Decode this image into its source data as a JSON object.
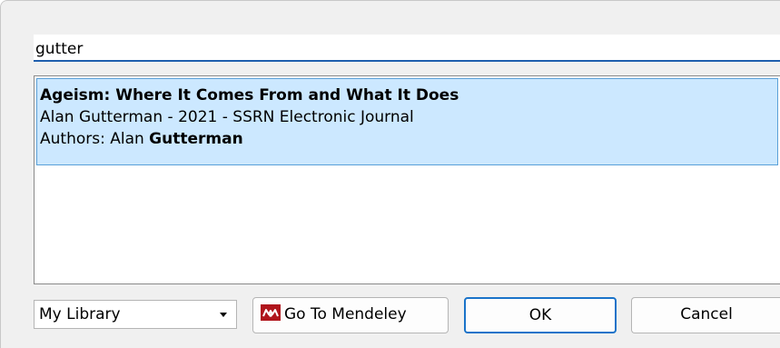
{
  "search": {
    "value": "gutter"
  },
  "results": [
    {
      "title": "Ageism: Where It Comes From and What It Does",
      "meta": "Alan Gutterman - 2021 - SSRN Electronic Journal",
      "authors_prefix": "Authors: Alan ",
      "authors_highlight": "Gutterman"
    }
  ],
  "footer": {
    "library_select": "My Library",
    "mendeley_button": "Go To Mendeley",
    "ok_button": "OK",
    "cancel_button": "Cancel"
  },
  "colors": {
    "selection_background": "#cce8ff",
    "selection_border": "#5aa0d8",
    "accent": "#1a73c9",
    "mendeley_icon": "#b0151c"
  },
  "icons": {
    "mendeley": "mendeley-logo-icon",
    "dropdown": "chevron-down-icon"
  }
}
